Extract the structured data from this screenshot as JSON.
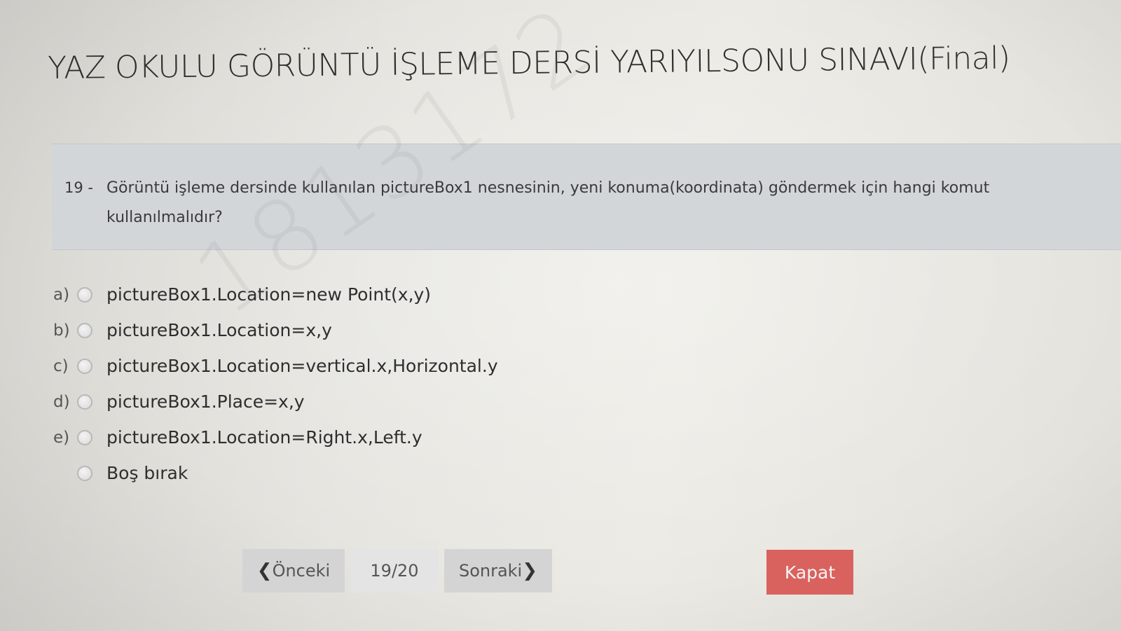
{
  "header": {
    "title": "YAZ OKULU GÖRÜNTÜ İŞLEME DERSİ YARIYILSONU SINAVI(Final)"
  },
  "question": {
    "number": "19 -",
    "text": "Görüntü işleme dersinde kullanılan pictureBox1 nesnesinin, yeni konuma(koordinata) göndermek için hangi komut kullanılmalıdır?"
  },
  "options": [
    {
      "letter": "a)",
      "label": "pictureBox1.Location=new Point(x,y)"
    },
    {
      "letter": "b)",
      "label": "pictureBox1.Location=x,y"
    },
    {
      "letter": "c)",
      "label": "pictureBox1.Location=vertical.x,Horizontal.y"
    },
    {
      "letter": "d)",
      "label": "pictureBox1.Place=x,y"
    },
    {
      "letter": "e)",
      "label": "pictureBox1.Location=Right.x,Left.y"
    },
    {
      "letter": "",
      "label": "Boş bırak"
    }
  ],
  "watermark": "1813172",
  "navigation": {
    "prev_icon": "chevron-left-icon",
    "prev_label": "Önceki",
    "page_indicator": "19/20",
    "next_label": "Sonraki",
    "next_icon": "chevron-right-icon",
    "close_label": "Kapat"
  },
  "colors": {
    "close_button": "#d9625e",
    "question_box": "#d3d6d9",
    "nav_button": "#d4d4d4"
  }
}
